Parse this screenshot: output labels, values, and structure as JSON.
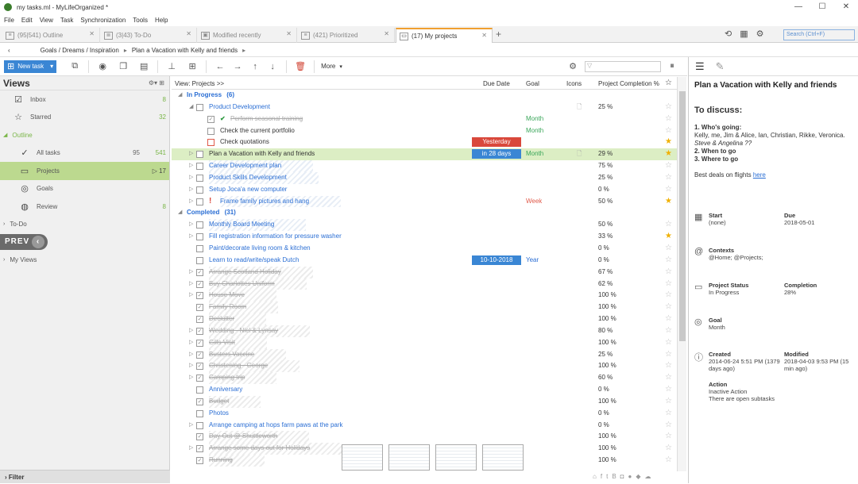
{
  "window": {
    "title": "my tasks.ml - MyLifeOrganized *",
    "controls": [
      "—",
      "☐",
      "✕"
    ]
  },
  "menu": [
    "File",
    "Edit",
    "View",
    "Task",
    "Synchronization",
    "Tools",
    "Help"
  ],
  "tabs": [
    {
      "label": "(95|541) Outline",
      "icon": "outline-icon"
    },
    {
      "label": "(3|43) To-Do",
      "icon": "todo-icon"
    },
    {
      "label": "Modified recently",
      "icon": "modified-icon"
    },
    {
      "label": "(421) Prioritized",
      "icon": "prioritized-icon"
    },
    {
      "label": "(17) My projects",
      "icon": "projects-icon",
      "active": true
    }
  ],
  "search": {
    "placeholder": "Search (Ctrl+F)"
  },
  "breadcrumb": [
    "Goals / Dreams / Inspiration",
    "Plan a Vacation with Kelly and friends"
  ],
  "toolbar": {
    "new_task": "New task",
    "more": "More",
    "filter_placeholder": "▽"
  },
  "sidebar": {
    "title": "Views",
    "items": [
      {
        "label": "Inbox",
        "count2": "8",
        "icon": "inbox-icon"
      },
      {
        "label": "Starred",
        "count2": "32",
        "icon": "star-icon"
      },
      {
        "label": "Outline",
        "section": true
      },
      {
        "label": "All tasks",
        "count1": "95",
        "count2": "541",
        "icon": "all-tasks-icon"
      },
      {
        "label": "Projects",
        "count2": "▷ 17",
        "icon": "projects-icon",
        "selected": true
      },
      {
        "label": "Goals",
        "icon": "goals-icon"
      },
      {
        "label": "Review",
        "count2": "8",
        "icon": "review-icon"
      },
      {
        "label": "To-Do",
        "section": true
      },
      {
        "label": "My Views",
        "section": true
      }
    ],
    "prev": "PREV",
    "filter": "Filter"
  },
  "grid": {
    "headers": {
      "view": "View: Projects >>",
      "due": "Due Date",
      "goal": "Goal",
      "icons": "Icons",
      "completion": "Project Completion %"
    },
    "rows": [
      {
        "type": "group",
        "name": "In Progress",
        "count": "(6)",
        "indent": 0
      },
      {
        "name": "Product Development",
        "indent": 1,
        "arrow": "◢",
        "style": "link",
        "icon": "🗋",
        "pct": "25 %"
      },
      {
        "name": "Perform seasonal training",
        "indent": 2,
        "check": "✓",
        "tick": true,
        "style": "done",
        "goal": "Month"
      },
      {
        "name": "Check the current portfolio",
        "indent": 2,
        "goal": "Month"
      },
      {
        "name": "Check quotations",
        "indent": 2,
        "cbred": true,
        "due": "Yesterday",
        "duecls": "red",
        "star": true
      },
      {
        "name": "Plan a Vacation with Kelly and friends",
        "indent": 1,
        "arrow": "▷",
        "selected": true,
        "due": "in 28 days",
        "duecls": "blue",
        "goal": "Month",
        "icon": "🗋",
        "pct": "29 %",
        "star": true
      },
      {
        "name": "Career Development plan",
        "indent": 1,
        "arrow": "▷",
        "style": "link",
        "hatch": true,
        "pct": "75 %"
      },
      {
        "name": "Product Skills Development",
        "indent": 1,
        "arrow": "▷",
        "style": "link",
        "hatch": true,
        "pct": "25 %"
      },
      {
        "name": "Setup Joca'a new computer",
        "indent": 1,
        "arrow": "▷",
        "style": "link",
        "pct": "0 %"
      },
      {
        "name": "Frame family pictures and hang",
        "indent": 1,
        "arrow": "▷",
        "style": "link",
        "excl": true,
        "hatch": true,
        "goal": "Week",
        "goalcls": "red",
        "pct": "50 %",
        "star": true
      },
      {
        "type": "group",
        "name": "Completed",
        "count": "(31)",
        "indent": 0
      },
      {
        "name": "Monthly Board Meeting",
        "indent": 1,
        "arrow": "▷",
        "style": "link",
        "hatch": true,
        "pct": "50 %"
      },
      {
        "name": "Fill registration information for pressure washer",
        "indent": 1,
        "arrow": "▷",
        "style": "link",
        "pct": "33 %",
        "star": true
      },
      {
        "name": "Paint/decorate living room & kitchen",
        "indent": 1,
        "style": "link",
        "pct": "0 %"
      },
      {
        "name": "Learn to read/write/speak Dutch",
        "indent": 1,
        "style": "link",
        "due": "10-10-2018",
        "duecls": "blue",
        "goal": "Year",
        "goalcls": "blue",
        "pct": "0 %"
      },
      {
        "name": "Arrange Scotland Holiday",
        "indent": 1,
        "arrow": "▷",
        "check": "✓",
        "style": "done",
        "hatchg": true,
        "pct": "67 %"
      },
      {
        "name": "Buy Charlottes Uniform",
        "indent": 1,
        "arrow": "▷",
        "check": "✓",
        "style": "done",
        "hatchg": true,
        "pct": "62 %"
      },
      {
        "name": "House Move",
        "indent": 1,
        "arrow": "▷",
        "check": "✓",
        "style": "done",
        "hatchg": true,
        "pct": "100 %"
      },
      {
        "name": "Family Room",
        "indent": 1,
        "check": "✓",
        "style": "done",
        "hatchg": true,
        "pct": "100 %"
      },
      {
        "name": "Declutter",
        "indent": 1,
        "check": "✓",
        "style": "done",
        "hatchg": true,
        "pct": "100 %"
      },
      {
        "name": "Wedding - Niel & Lynsay",
        "indent": 1,
        "arrow": "▷",
        "check": "✓",
        "style": "done",
        "hatchg": true,
        "pct": "80 %"
      },
      {
        "name": "Gills Visit",
        "indent": 1,
        "arrow": "▷",
        "check": "✓",
        "style": "done",
        "hatchg": true,
        "pct": "100 %"
      },
      {
        "name": "Busters Vaccine",
        "indent": 1,
        "arrow": "▷",
        "check": "✓",
        "style": "done",
        "hatchg": true,
        "pct": "25 %"
      },
      {
        "name": "Christening - George",
        "indent": 1,
        "arrow": "▷",
        "check": "✓",
        "style": "done",
        "hatchg": true,
        "pct": "100 %"
      },
      {
        "name": "Camping trip",
        "indent": 1,
        "arrow": "▷",
        "check": "✓",
        "style": "done",
        "hatchg": true,
        "pct": "60 %"
      },
      {
        "name": "Anniversary",
        "indent": 1,
        "style": "link",
        "pct": "0 %"
      },
      {
        "name": "Budget",
        "indent": 1,
        "check": "✓",
        "style": "done",
        "hatchg": true,
        "pct": "100 %"
      },
      {
        "name": "Photos",
        "indent": 1,
        "style": "link",
        "pct": "0 %"
      },
      {
        "name": "Arrange camping at hops farm paws at the park",
        "indent": 1,
        "arrow": "▷",
        "style": "link",
        "pct": "0 %"
      },
      {
        "name": "Day Out @ Shuttleworth",
        "indent": 1,
        "check": "✓",
        "style": "done",
        "hatchg": true,
        "pct": "100 %"
      },
      {
        "name": "Arrange some days out for Holidays",
        "indent": 1,
        "arrow": "▷",
        "check": "✓",
        "style": "done",
        "hatchg": true,
        "pct": "100 %"
      },
      {
        "name": "Running",
        "indent": 1,
        "check": "✓",
        "style": "done",
        "hatchg": true,
        "pct": "100 %"
      }
    ]
  },
  "details": {
    "title": "Plan a Vacation with Kelly and friends",
    "note": {
      "heading": "To discuss:",
      "l1": "1. Who's going:",
      "l2": "Kelly, me, Jim & Alice, Ian, Christian, Rikke, Veronica.",
      "l3": "Steve & Angelina ??",
      "l4": "2. When to go",
      "l5": "3. Where to go",
      "l6": "Best deals on flights",
      "link": "here"
    },
    "start_label": "Start",
    "start_val": "(none)",
    "due_label": "Due",
    "due_val": "2018-05-01",
    "contexts_label": "Contexts",
    "contexts_val": "@Home; @Projects;",
    "status_label": "Project Status",
    "status_val": "In Progress",
    "completion_label": "Completion",
    "completion_val": "28%",
    "goal_label": "Goal",
    "goal_val": "Month",
    "created_label": "Created",
    "created_val": "2014-06-24 5:51 PM (1379 days ago)",
    "modified_label": "Modified",
    "modified_val": "2018-04-03 9:53 PM (15 min ago)",
    "action_label": "Action",
    "action_val1": "Inactive Action",
    "action_val2": "There are open subtasks"
  },
  "colors": {
    "accent": "#3a86d4",
    "selected_green": "#bcd98f",
    "due_red": "#d9483b",
    "due_blue": "#3a86d4",
    "star": "#f0b000"
  }
}
